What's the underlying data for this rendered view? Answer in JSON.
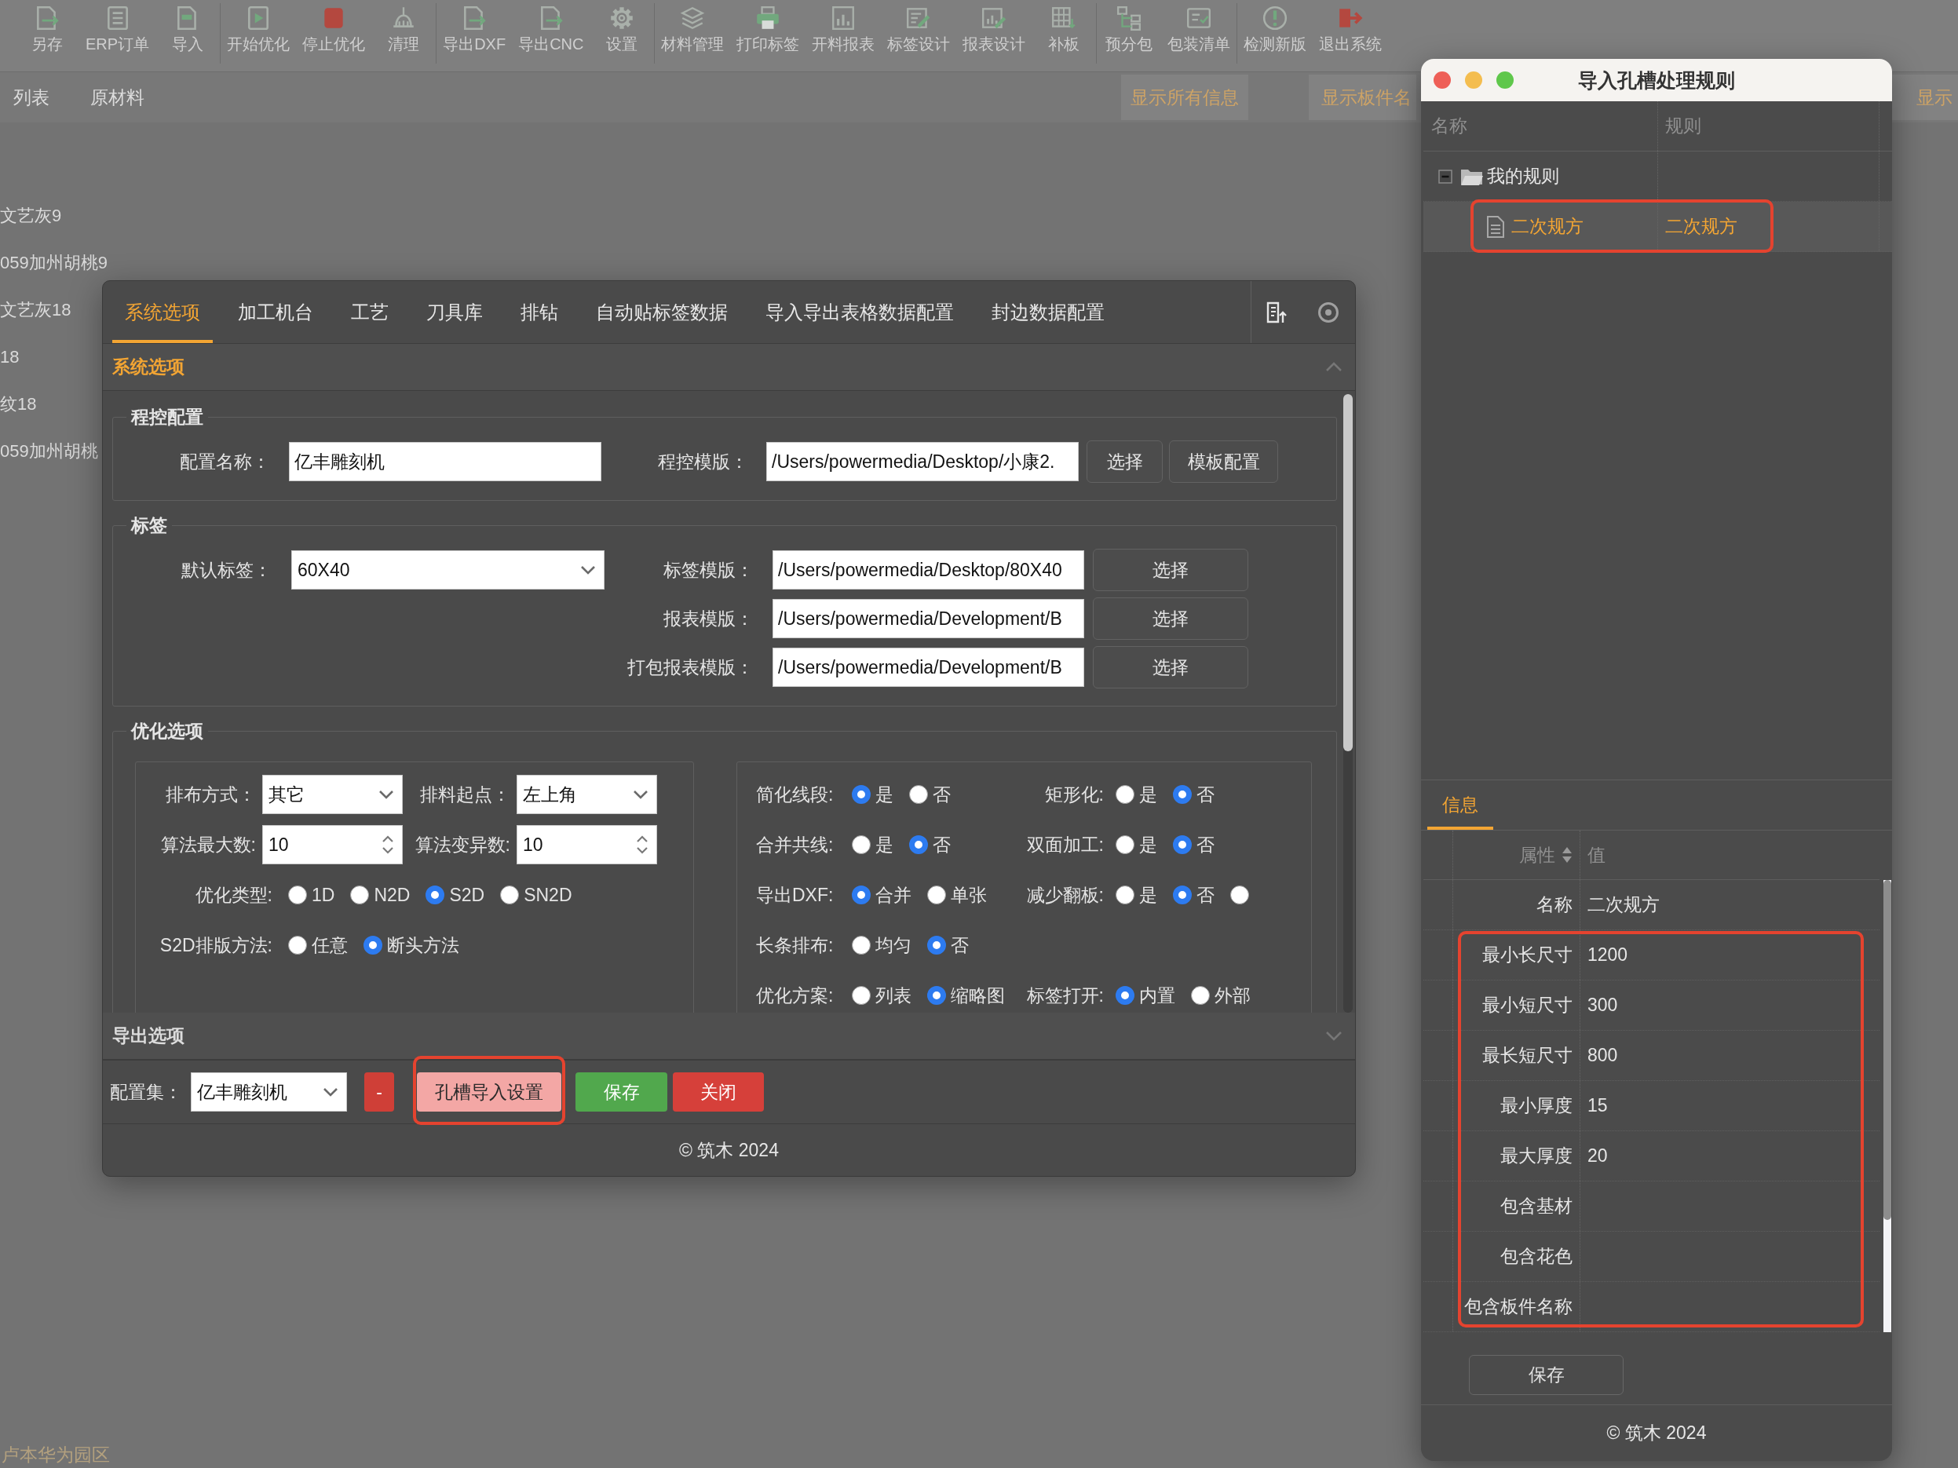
{
  "app": {
    "toolbar": [
      [
        "另存",
        "ERP订单",
        "导入"
      ],
      [
        "开始优化",
        "停止优化",
        "清理"
      ],
      [
        "导出DXF",
        "导出CNC",
        "设置"
      ],
      [
        "材料管理",
        "打印标签",
        "开料报表",
        "标签设计",
        "报表设计",
        "补板"
      ],
      [
        "预分包",
        "包装清单"
      ],
      [
        "检测新版",
        "退出系统"
      ]
    ],
    "view_tabs": [
      "列表",
      "原材料"
    ],
    "filter_buttons": [
      "显示所有信息",
      "显示板件名",
      "显示"
    ],
    "list": [
      "文艺灰9",
      "059加州胡桃9",
      "文艺灰18",
      "18",
      "纹18",
      "059加州胡桃"
    ],
    "bottom_text": "卢本华为园区"
  },
  "settings_dialog": {
    "tabs": [
      {
        "label": "系统选项",
        "selected": true
      },
      {
        "label": "加工机台",
        "selected": false
      },
      {
        "label": "工艺",
        "selected": false
      },
      {
        "label": "刀具库",
        "selected": false
      },
      {
        "label": "排钻",
        "selected": false
      },
      {
        "label": "自动贴标签数据",
        "selected": false
      },
      {
        "label": "导入导出表格数据配置",
        "selected": false
      },
      {
        "label": "封边数据配置",
        "selected": false
      }
    ],
    "sections": [
      {
        "title": "系统选项",
        "expanded": true,
        "groups": [
          {
            "kind": "program",
            "title": "程控配置",
            "name_field": {
              "label": "配置名称：",
              "value": "亿丰雕刻机"
            },
            "template_field": {
              "label": "程控模版：",
              "value": "/Users/powermedia/Desktop/小康2."
            },
            "buttons": [
              "选择",
              "模板配置"
            ]
          },
          {
            "kind": "labels",
            "title": "标签",
            "default_label": {
              "label": "默认标签：",
              "value": "60X40"
            },
            "templates": [
              {
                "label": "标签模版：",
                "value": "/Users/powermedia/Desktop/80X40",
                "button": "选择"
              },
              {
                "label": "报表模版：",
                "value": "/Users/powermedia/Development/B",
                "button": "选择"
              },
              {
                "label": "打包报表模版：",
                "value": "/Users/powermedia/Development/B",
                "button": "选择"
              }
            ]
          },
          {
            "kind": "optimization",
            "title": "优化选项",
            "panels": [
              {
                "rows": [
                  [
                    {
                      "kind": "select",
                      "label": "排布方式：",
                      "value": "其它"
                    },
                    {
                      "kind": "select",
                      "label": "排料起点：",
                      "value": "左上角"
                    }
                  ],
                  [
                    {
                      "kind": "spinner",
                      "label": "算法最大数:",
                      "value": "10"
                    },
                    {
                      "kind": "spinner",
                      "label": "算法变异数:",
                      "value": "10"
                    }
                  ],
                  [
                    {
                      "kind": "radios",
                      "label": "优化类型:",
                      "options": [
                        {
                          "label": "1D",
                          "selected": false
                        },
                        {
                          "label": "N2D",
                          "selected": false
                        },
                        {
                          "label": "S2D",
                          "selected": true
                        },
                        {
                          "label": "SN2D",
                          "selected": false
                        }
                      ]
                    }
                  ],
                  [
                    {
                      "kind": "radios",
                      "label": "S2D排版方法:",
                      "options": [
                        {
                          "label": "任意",
                          "selected": false
                        },
                        {
                          "label": "断头方法",
                          "selected": true
                        }
                      ]
                    }
                  ]
                ]
              },
              {
                "rows": [
                  [
                    {
                      "kind": "radios",
                      "label": "简化线段:",
                      "options": [
                        {
                          "label": "是",
                          "selected": true
                        },
                        {
                          "label": "否",
                          "selected": false
                        }
                      ]
                    },
                    {
                      "kind": "radios",
                      "label": "矩形化:",
                      "options": [
                        {
                          "label": "是",
                          "selected": false
                        },
                        {
                          "label": "否",
                          "selected": true
                        }
                      ]
                    }
                  ],
                  [
                    {
                      "kind": "radios",
                      "label": "合并共线:",
                      "options": [
                        {
                          "label": "是",
                          "selected": false
                        },
                        {
                          "label": "否",
                          "selected": true
                        }
                      ]
                    },
                    {
                      "kind": "radios",
                      "label": "双面加工:",
                      "options": [
                        {
                          "label": "是",
                          "selected": false
                        },
                        {
                          "label": "否",
                          "selected": true
                        }
                      ]
                    }
                  ],
                  [
                    {
                      "kind": "radios",
                      "label": "导出DXF:",
                      "options": [
                        {
                          "label": "合并",
                          "selected": true
                        },
                        {
                          "label": "单张",
                          "selected": false
                        }
                      ]
                    },
                    {
                      "kind": "radios",
                      "label": "减少翻板:",
                      "options": [
                        {
                          "label": "是",
                          "selected": false
                        },
                        {
                          "label": "否",
                          "selected": true
                        },
                        {
                          "selected": false
                        }
                      ]
                    }
                  ],
                  [
                    {
                      "kind": "radios",
                      "label": "长条排布:",
                      "options": [
                        {
                          "label": "均匀",
                          "selected": false
                        },
                        {
                          "label": "否",
                          "selected": true
                        }
                      ]
                    }
                  ],
                  [
                    {
                      "kind": "radios",
                      "label": "优化方案:",
                      "options": [
                        {
                          "label": "列表",
                          "selected": false
                        },
                        {
                          "label": "缩略图",
                          "selected": true
                        }
                      ]
                    },
                    {
                      "kind": "radios",
                      "label": "标签打开:",
                      "options": [
                        {
                          "label": "内置",
                          "selected": true
                        },
                        {
                          "label": "外部",
                          "selected": false
                        }
                      ]
                    }
                  ]
                ]
              }
            ]
          }
        ]
      },
      {
        "title": "导出选项",
        "expanded": false
      }
    ],
    "config_set": {
      "label": "配置集：",
      "value": "亿丰雕刻机"
    },
    "buttons": [
      {
        "label": "-",
        "kind": "remove",
        "marked": false
      },
      {
        "label": "孔槽导入设置",
        "kind": "soft",
        "marked": true
      },
      {
        "label": "保存",
        "kind": "success",
        "marked": false
      },
      {
        "label": "关闭",
        "kind": "danger",
        "marked": false
      }
    ],
    "footer": "© 筑木 2024"
  },
  "rules_window": {
    "title": "导入孔槽处理规则",
    "tree": {
      "columns": [
        "名称",
        "规则"
      ],
      "nodes": [
        {
          "name": "我的规则",
          "expanded": true,
          "selected": false,
          "children": [
            {
              "name": "二次规方",
              "rule": "二次规方",
              "selected": true,
              "marked": true
            }
          ]
        }
      ]
    },
    "tabs": [
      {
        "label": "信息",
        "selected": true
      }
    ],
    "properties": {
      "columns": [
        "属性",
        "值"
      ],
      "row_groups": [
        {
          "marked": false,
          "rows": [
            {
              "name": "名称",
              "value": "二次规方"
            }
          ]
        },
        {
          "marked": true,
          "rows": [
            {
              "name": "最小长尺寸",
              "value": "1200"
            },
            {
              "name": "最小短尺寸",
              "value": "300"
            },
            {
              "name": "最长短尺寸",
              "value": "800"
            },
            {
              "name": "最小厚度",
              "value": "15"
            },
            {
              "name": "最大厚度",
              "value": "20"
            },
            {
              "name": "包含基材"
            },
            {
              "name": "包含花色"
            },
            {
              "name": "包含板件名称"
            }
          ]
        }
      ]
    },
    "save_button": "保存",
    "footer": "© 筑木 2024"
  }
}
